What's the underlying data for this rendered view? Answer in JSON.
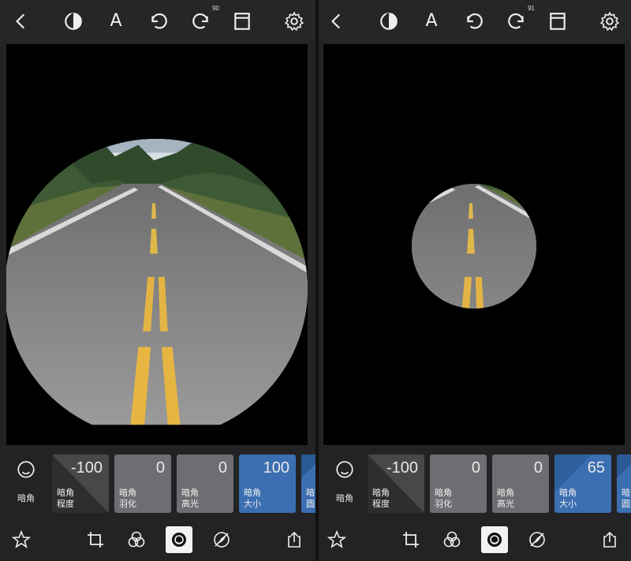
{
  "left": {
    "toolbar": {
      "redo_badge": "90"
    },
    "side_tool_label": "暗角",
    "tiles": [
      {
        "value": "-100",
        "line1": "暗角",
        "line2": "程度"
      },
      {
        "value": "0",
        "line1": "暗角",
        "line2": "羽化"
      },
      {
        "value": "0",
        "line1": "暗角",
        "line2": "高光"
      },
      {
        "value": "100",
        "line1": "暗角",
        "line2": "大小"
      },
      {
        "value": "",
        "line1": "暗",
        "line2": "圆"
      }
    ]
  },
  "right": {
    "toolbar": {
      "redo_badge": "91"
    },
    "side_tool_label": "暗角",
    "tiles": [
      {
        "value": "-100",
        "line1": "暗角",
        "line2": "程度"
      },
      {
        "value": "0",
        "line1": "暗角",
        "line2": "羽化"
      },
      {
        "value": "0",
        "line1": "暗角",
        "line2": "高光"
      },
      {
        "value": "65",
        "line1": "暗角",
        "line2": "大小"
      },
      {
        "value": "",
        "line1": "暗",
        "line2": "圆"
      }
    ]
  },
  "toolbar": {
    "text_tool_glyph": "A"
  },
  "colors": {
    "accent": "#3b6fb1",
    "background": "#232325",
    "canvas": "#000000"
  },
  "icons": [
    "back-icon",
    "mask-icon",
    "text-icon",
    "undo-icon",
    "redo-icon",
    "layout-icon",
    "gear-icon",
    "vignette-icon",
    "star-icon",
    "crop-icon",
    "filters-icon",
    "vignette-tool-icon",
    "heal-icon",
    "share-icon"
  ]
}
